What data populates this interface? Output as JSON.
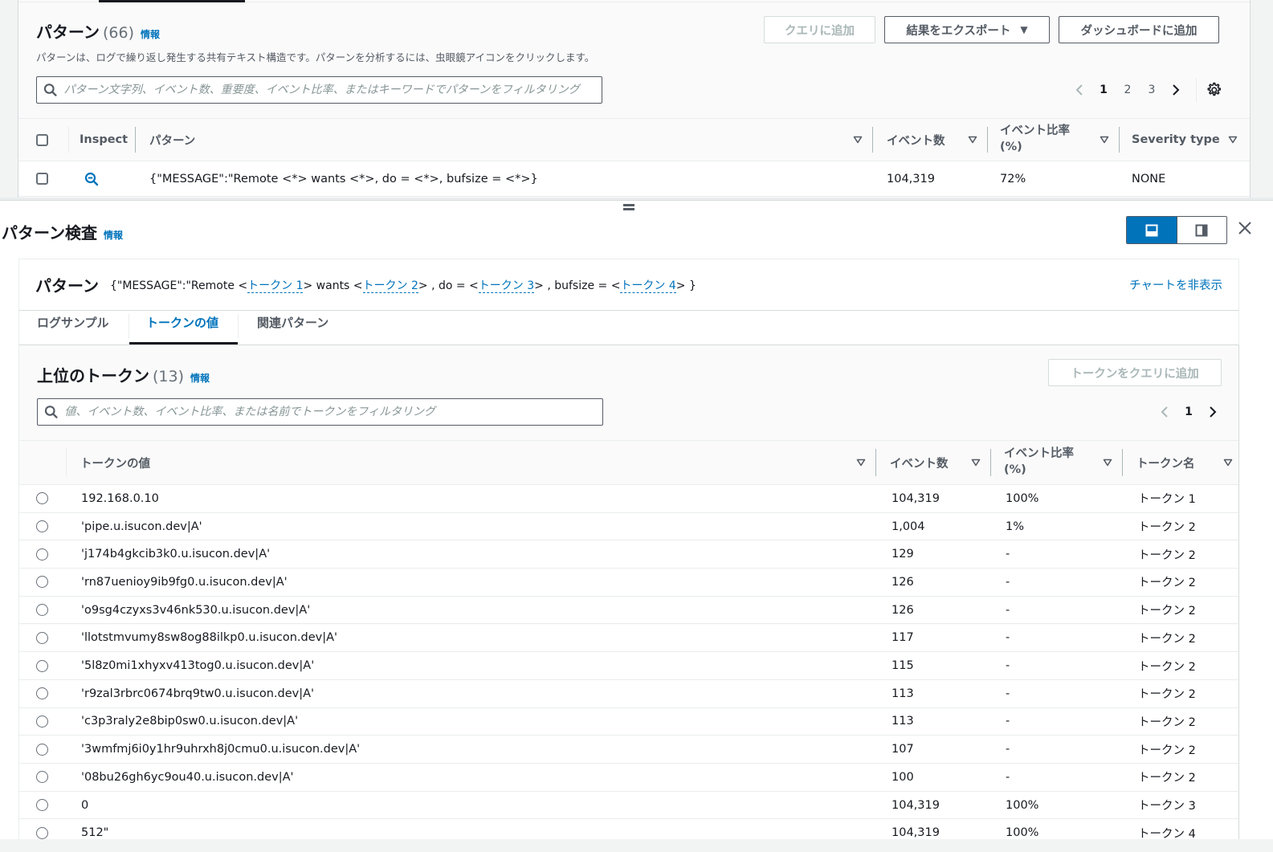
{
  "patterns": {
    "title": "パターン",
    "count": "(66)",
    "info": "情報",
    "description": "パターンは、ログで繰り返し発生する共有テキスト構造です。パターンを分析するには、虫眼鏡アイコンをクリックします。",
    "buttons": {
      "add_to_query": "クエリに追加",
      "export_results": "結果をエクスポート",
      "add_to_dashboard": "ダッシュボードに追加"
    },
    "search_placeholder": "パターン文字列、イベント数、重要度、イベント比率、またはキーワードでパターンをフィルタリング",
    "pagination": {
      "pages": [
        "1",
        "2",
        "3"
      ],
      "current": "1"
    },
    "columns": {
      "inspect": "Inspect",
      "pattern": "パターン",
      "event_count": "イベント数",
      "event_ratio_line1": "イベント比率",
      "event_ratio_line2": "(%)",
      "severity": "Severity type"
    },
    "rows": [
      {
        "pattern": "{\"MESSAGE\":\"Remote <*> wants <*>, do = <*>, bufsize = <*>}",
        "event_count": "104,319",
        "event_ratio": "72%",
        "severity": "NONE"
      }
    ]
  },
  "inspect": {
    "title": "パターン検査",
    "info": "情報",
    "view_modes": [
      "bottom-panel",
      "side-panel"
    ],
    "active_view": "bottom-panel",
    "pattern_label": "パターン",
    "pattern_parts": {
      "p0": "{\"MESSAGE\":\"Remote <",
      "t1": "トークン 1",
      "p1": "> wants <",
      "t2": "トークン 2",
      "p2": "> , do = <",
      "t3": "トークン 3",
      "p3": "> , bufsize = <",
      "t4": "トークン 4",
      "p4": "> }"
    },
    "hide_chart": "チャートを非表示",
    "tabs": [
      {
        "label": "ログサンプル",
        "active": false
      },
      {
        "label": "トークンの値",
        "active": true
      },
      {
        "label": "関連パターン",
        "active": false
      }
    ]
  },
  "tokens": {
    "title": "上位のトークン",
    "count": "(13)",
    "info": "情報",
    "add_button": "トークンをクエリに追加",
    "search_placeholder": "値、イベント数、イベント比率、または名前でトークンをフィルタリング",
    "pagination": {
      "current": "1"
    },
    "columns": {
      "value": "トークンの値",
      "event_count": "イベント数",
      "event_ratio_line1": "イベント比率",
      "event_ratio_line2": "(%)",
      "token_name": "トークン名"
    },
    "rows": [
      {
        "value": "192.168.0.10",
        "event_count": "104,319",
        "event_ratio": "100%",
        "token_name": "トークン 1"
      },
      {
        "value": "'pipe.u.isucon.dev|A'",
        "event_count": "1,004",
        "event_ratio": "1%",
        "token_name": "トークン 2"
      },
      {
        "value": "'j174b4gkcib3k0.u.isucon.dev|A'",
        "event_count": "129",
        "event_ratio": "-",
        "token_name": "トークン 2"
      },
      {
        "value": "'rn87uenioy9ib9fg0.u.isucon.dev|A'",
        "event_count": "126",
        "event_ratio": "-",
        "token_name": "トークン 2"
      },
      {
        "value": "'o9sg4czyxs3v46nk530.u.isucon.dev|A'",
        "event_count": "126",
        "event_ratio": "-",
        "token_name": "トークン 2"
      },
      {
        "value": "'llotstmvumy8sw8og88ilkp0.u.isucon.dev|A'",
        "event_count": "117",
        "event_ratio": "-",
        "token_name": "トークン 2"
      },
      {
        "value": "'5l8z0mi1xhyxv413tog0.u.isucon.dev|A'",
        "event_count": "115",
        "event_ratio": "-",
        "token_name": "トークン 2"
      },
      {
        "value": "'r9zal3rbrc0674brq9tw0.u.isucon.dev|A'",
        "event_count": "113",
        "event_ratio": "-",
        "token_name": "トークン 2"
      },
      {
        "value": "'c3p3raly2e8bip0sw0.u.isucon.dev|A'",
        "event_count": "113",
        "event_ratio": "-",
        "token_name": "トークン 2"
      },
      {
        "value": "'3wmfmj6i0y1hr9uhrxh8j0cmu0.u.isucon.dev|A'",
        "event_count": "107",
        "event_ratio": "-",
        "token_name": "トークン 2"
      },
      {
        "value": "'08bu26gh6yc9ou40.u.isucon.dev|A'",
        "event_count": "100",
        "event_ratio": "-",
        "token_name": "トークン 2"
      },
      {
        "value": "0",
        "event_count": "104,319",
        "event_ratio": "100%",
        "token_name": "トークン 3"
      },
      {
        "value": "512\"",
        "event_count": "104,319",
        "event_ratio": "100%",
        "token_name": "トークン 4"
      }
    ]
  },
  "colors": {
    "accent": "#0073bb",
    "text": "#16191f",
    "muted": "#545b64",
    "disabled": "#aab7b8"
  }
}
